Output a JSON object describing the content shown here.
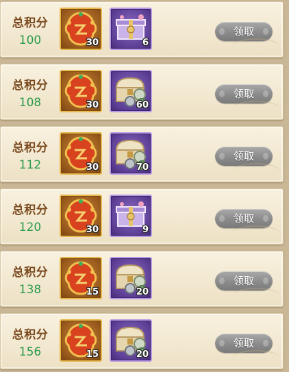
{
  "rows": [
    {
      "label": "总积分",
      "score": "100",
      "items": [
        {
          "icon": "red-badge-icon",
          "count": "30"
        },
        {
          "icon": "purple-gift-box-icon",
          "count": "6"
        }
      ],
      "button": "领取"
    },
    {
      "label": "总积分",
      "score": "108",
      "items": [
        {
          "icon": "red-badge-icon",
          "count": "30"
        },
        {
          "icon": "treasure-chest-coins-icon",
          "count": "60"
        }
      ],
      "button": "领取"
    },
    {
      "label": "总积分",
      "score": "112",
      "items": [
        {
          "icon": "red-badge-icon",
          "count": "30"
        },
        {
          "icon": "treasure-chest-coins-icon",
          "count": "70"
        }
      ],
      "button": "领取"
    },
    {
      "label": "总积分",
      "score": "120",
      "items": [
        {
          "icon": "red-badge-icon",
          "count": "30"
        },
        {
          "icon": "purple-gift-box-icon",
          "count": "9"
        }
      ],
      "button": "领取"
    },
    {
      "label": "总积分",
      "score": "138",
      "items": [
        {
          "icon": "red-badge-icon",
          "count": "15"
        },
        {
          "icon": "treasure-chest-coins-icon",
          "count": "20"
        }
      ],
      "button": "领取"
    },
    {
      "label": "总积分",
      "score": "156",
      "items": [
        {
          "icon": "red-badge-icon",
          "count": "15"
        },
        {
          "icon": "treasure-chest-coins-icon",
          "count": "20"
        }
      ],
      "button": "领取"
    }
  ],
  "colors": {
    "score": "#2a9a4a",
    "label": "#7a4a1f",
    "button": "#8b8b8b"
  }
}
